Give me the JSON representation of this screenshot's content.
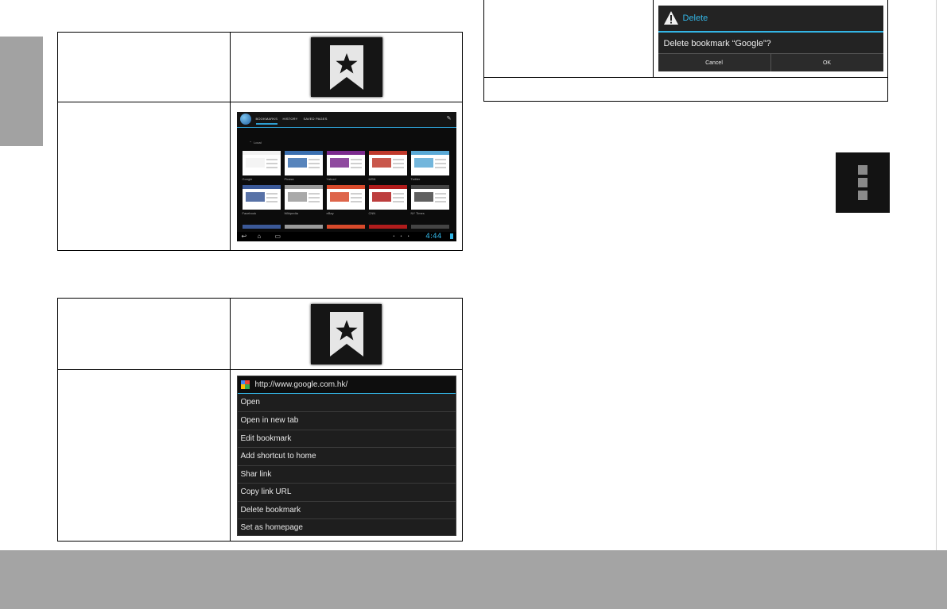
{
  "colors": {
    "side_tab": "#a2a2a2",
    "footer_band": "#a4a4a4",
    "holo_blue": "#33b5e5"
  },
  "bookmarks_view": {
    "tabs": [
      "BOOKMARKS",
      "HISTORY",
      "SAVED PAGES"
    ],
    "folder": "Local",
    "tiles": [
      {
        "label": "Google",
        "color": "#f2f2f2"
      },
      {
        "label": "Picasa",
        "color": "#3a6fb0"
      },
      {
        "label": "Yahoo!",
        "color": "#7b2a8e"
      },
      {
        "label": "MSN",
        "color": "#c0392b"
      },
      {
        "label": "Twitter",
        "color": "#5aa9d6"
      },
      {
        "label": "Facebook",
        "color": "#3b5998"
      },
      {
        "label": "Wikipedia",
        "color": "#9a9a9a"
      },
      {
        "label": "eBay",
        "color": "#d84a2b"
      },
      {
        "label": "CNN",
        "color": "#b11c1c"
      },
      {
        "label": "NY Times",
        "color": "#444444"
      }
    ],
    "clock": "4:44"
  },
  "context_menu": {
    "url": "http://www.google.com.hk/",
    "items": [
      "Open",
      "Open in new tab",
      "Edit bookmark",
      "Add shortcut to home",
      "Shar link",
      "Copy link URL",
      "Delete bookmark",
      "Set as homepage"
    ]
  },
  "delete_dialog": {
    "title": "Delete",
    "message": "Delete bookmark “Google”?",
    "cancel": "Cancel",
    "ok": "OK"
  },
  "icons": {
    "bookmark": "bookmark-star-icon",
    "overflow_menu": "overflow-menu-icon",
    "warning": "warning-icon"
  }
}
